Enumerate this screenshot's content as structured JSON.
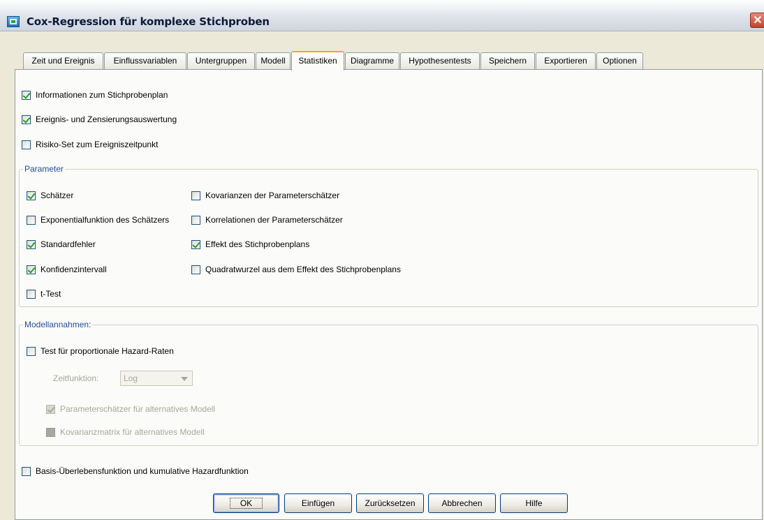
{
  "window": {
    "title": "Cox-Regression für komplexe Stichproben",
    "close_glyph": "✕"
  },
  "tabs": [
    {
      "label": "Zeit und Ereignis"
    },
    {
      "label": "Einflussvariablen"
    },
    {
      "label": "Untergruppen"
    },
    {
      "label": "Modell"
    },
    {
      "label": "Statistiken",
      "active": true
    },
    {
      "label": "Diagramme"
    },
    {
      "label": "Hypothesentests"
    },
    {
      "label": "Speichern"
    },
    {
      "label": "Exportieren"
    },
    {
      "label": "Optionen"
    }
  ],
  "top_options": [
    {
      "label": "Informationen zum Stichprobenplan",
      "checked": true
    },
    {
      "label": "Ereignis- und Zensierungsauswertung",
      "checked": true
    },
    {
      "label": "Risiko-Set zum Ereigniszeitpunkt",
      "checked": false
    }
  ],
  "parameter": {
    "title": "Parameter",
    "left": [
      {
        "label": "Schätzer",
        "checked": true
      },
      {
        "label": "Exponentialfunktion des Schätzers",
        "checked": false
      },
      {
        "label": "Standardfehler",
        "checked": true
      },
      {
        "label": "Konfidenzintervall",
        "checked": true
      },
      {
        "label": "t-Test",
        "checked": false
      }
    ],
    "right": [
      {
        "label": "Kovarianzen der Parameterschätzer",
        "checked": false
      },
      {
        "label": "Korrelationen der Parameterschätzer",
        "checked": false
      },
      {
        "label": "Effekt des Stichprobenplans",
        "checked": true
      },
      {
        "label": "Quadratwurzel aus dem Effekt des Stichprobenplans",
        "checked": false
      }
    ]
  },
  "model_assumptions": {
    "title": "Modellannahmen:",
    "test_label": "Test für proportionale Hazard-Raten",
    "time_function_label": "Zeitfunktion:",
    "time_function_value": "Log",
    "param_estimates_label": "Parameterschätzer für alternatives Modell",
    "cov_matrix_label": "Kovarianzmatrix für alternatives Modell"
  },
  "baseline_label": "Basis-Überlebensfunktion und kumulative Hazardfunktion",
  "buttons": {
    "ok": "OK",
    "paste": "Einfügen",
    "reset": "Zurücksetzen",
    "cancel": "Abbrechen",
    "help": "Hilfe"
  },
  "icons": {
    "app": "spss-app-icon",
    "close": "close-icon",
    "dropdown": "chevron-down-icon"
  }
}
